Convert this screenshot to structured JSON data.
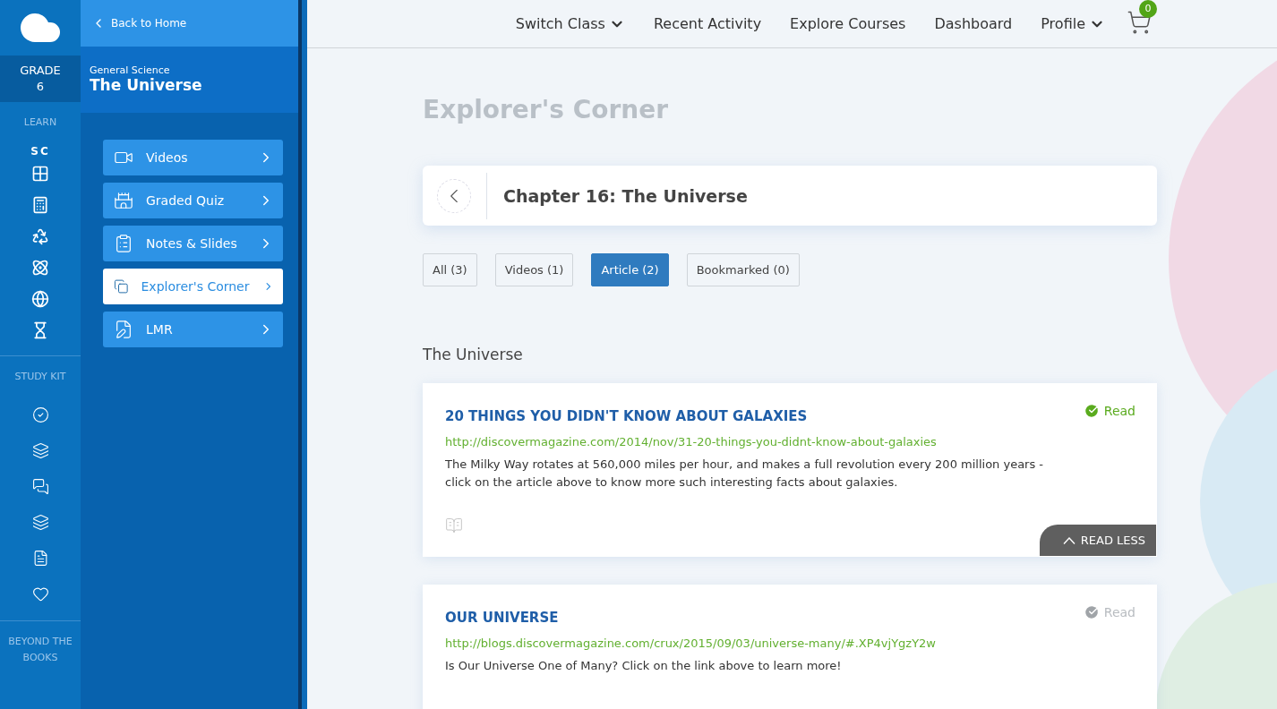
{
  "rail": {
    "grade_label": "GRADE",
    "grade_number": "6",
    "learn_label": "LEARN",
    "learn_code": "SC",
    "study_kit_label": "STUDY KIT",
    "beyond_label": "BEYOND THE BOOKS"
  },
  "panel": {
    "back_label": "Back to Home",
    "subject": "General Science",
    "chapter": "The Universe",
    "menu": [
      {
        "label": "Videos",
        "selected": false
      },
      {
        "label": "Graded Quiz",
        "selected": false
      },
      {
        "label": "Notes & Slides",
        "selected": false
      },
      {
        "label": "Explorer's Corner",
        "selected": true
      },
      {
        "label": "LMR",
        "selected": false
      }
    ]
  },
  "top_nav": {
    "items": [
      {
        "label": "Switch Class",
        "dropdown": true
      },
      {
        "label": "Recent Activity",
        "dropdown": false
      },
      {
        "label": "Explore Courses",
        "dropdown": false
      },
      {
        "label": "Dashboard",
        "dropdown": false
      },
      {
        "label": "Profile",
        "dropdown": true
      }
    ],
    "cart_count": "0"
  },
  "page_title": "Explorer's Corner",
  "chapter_title": "Chapter 16: The Universe",
  "filters": [
    {
      "label": "All (3)",
      "selected": false
    },
    {
      "label": "Videos (1)",
      "selected": false
    },
    {
      "label": "Article (2)",
      "selected": true
    },
    {
      "label": "Bookmarked (0)",
      "selected": false
    }
  ],
  "section_title": "The Universe",
  "articles": [
    {
      "title": "20 THINGS YOU DIDN'T KNOW ABOUT GALAXIES",
      "url": "http://discovermagazine.com/2014/nov/31-20-things-you-didnt-know-about-galaxies",
      "description": "The Milky Way rotates at 560,000 miles per hour, and makes a full revolution every 200 million years - click on the article above to know more such interesting facts about galaxies.",
      "read_label": "Read",
      "read": true,
      "expanded": true,
      "toggle_label": "READ LESS"
    },
    {
      "title": "OUR UNIVERSE",
      "url": "http://blogs.discovermagazine.com/crux/2015/09/03/universe-many/#.XP4vjYgzY2w",
      "description": "Is Our Universe One of Many? Click on the link above to learn more!",
      "read_label": "Read",
      "read": false,
      "expanded": false
    }
  ]
}
